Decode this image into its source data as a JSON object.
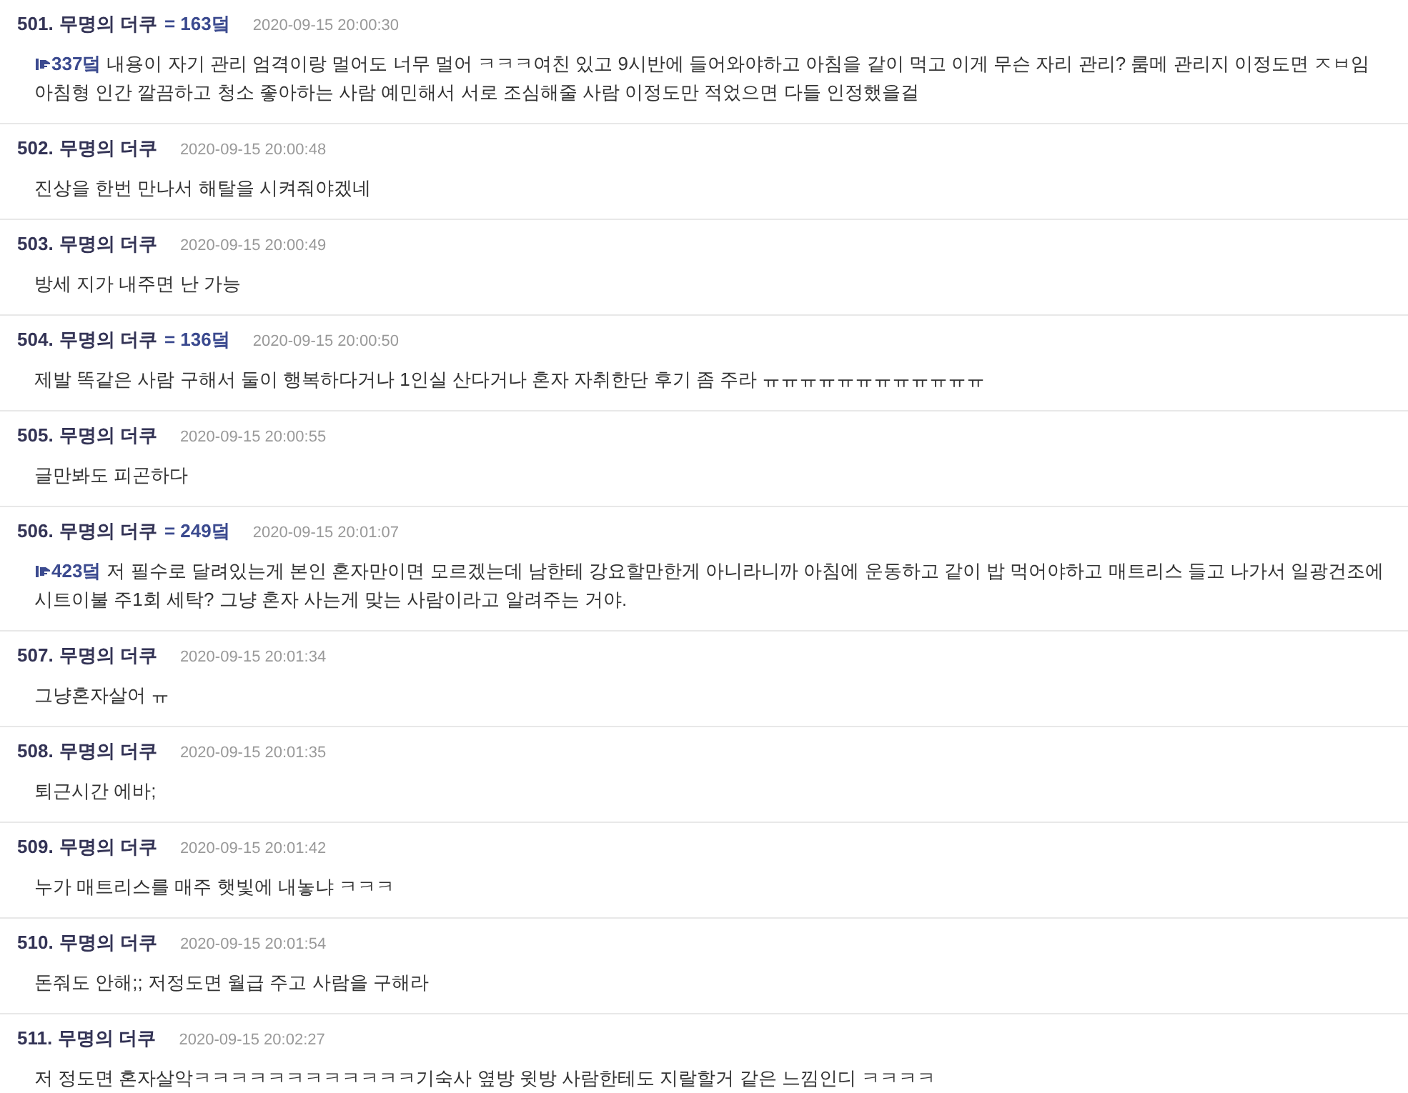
{
  "posts": [
    {
      "number": "501.",
      "author": "무명의 더쿠",
      "score": "= 163덬",
      "time": "2020-09-15 20:00:30",
      "reply_to": "337덬",
      "body": "내용이 자기 관리 엄격이랑 멀어도 너무 멀어 ㅋㅋㅋ여친 있고 9시반에 들어와야하고 아침을 같이 먹고 이게 무슨 자리 관리? 룸메 관리지 이정도면 ㅈㅂ임 아침형 인간 깔끔하고 청소 좋아하는 사람 예민해서 서로 조심해줄 사람 이정도만 적었으면 다들 인정했을걸"
    },
    {
      "number": "502.",
      "author": "무명의 더쿠",
      "time": "2020-09-15 20:00:48",
      "body": "진상을 한번 만나서 해탈을 시켜줘야겠네"
    },
    {
      "number": "503.",
      "author": "무명의 더쿠",
      "time": "2020-09-15 20:00:49",
      "body": "방세 지가 내주면 난 가능"
    },
    {
      "number": "504.",
      "author": "무명의 더쿠",
      "score": "= 136덬",
      "time": "2020-09-15 20:00:50",
      "body": "제발 똑같은 사람 구해서 둘이 행복하다거나 1인실 산다거나 혼자 자취한단 후기 좀 주라 ㅠㅠㅠㅠㅠㅠㅠㅠㅠㅠㅠㅠ"
    },
    {
      "number": "505.",
      "author": "무명의 더쿠",
      "time": "2020-09-15 20:00:55",
      "body": "글만봐도 피곤하다"
    },
    {
      "number": "506.",
      "author": "무명의 더쿠",
      "score": "= 249덬",
      "time": "2020-09-15 20:01:07",
      "reply_to": "423덬",
      "body": "저 필수로 달려있는게 본인 혼자만이면 모르겠는데 남한테 강요할만한게 아니라니까 아침에 운동하고 같이 밥 먹어야하고 매트리스 들고 나가서 일광건조에 시트이불 주1회 세탁? 그냥 혼자 사는게 맞는 사람이라고 알려주는 거야."
    },
    {
      "number": "507.",
      "author": "무명의 더쿠",
      "time": "2020-09-15 20:01:34",
      "body": "그냥혼자살어 ㅠ"
    },
    {
      "number": "508.",
      "author": "무명의 더쿠",
      "time": "2020-09-15 20:01:35",
      "body": "퇴근시간 에바;"
    },
    {
      "number": "509.",
      "author": "무명의 더쿠",
      "time": "2020-09-15 20:01:42",
      "body": "누가 매트리스를 매주 햇빛에 내놓냐 ㅋㅋㅋ"
    },
    {
      "number": "510.",
      "author": "무명의 더쿠",
      "time": "2020-09-15 20:01:54",
      "body": "돈줘도 안해;; 저정도면 월급 주고 사람을 구해라"
    },
    {
      "number": "511.",
      "author": "무명의 더쿠",
      "time": "2020-09-15 20:02:27",
      "body": "저 정도면 혼자살악ㅋㅋㅋㅋㅋㅋㅋㅋㅋㅋㅋㅋ기숙사 옆방 윗방 사람한테도 지랄할거 같은 느낌인디 ㅋㅋㅋㅋ"
    }
  ]
}
